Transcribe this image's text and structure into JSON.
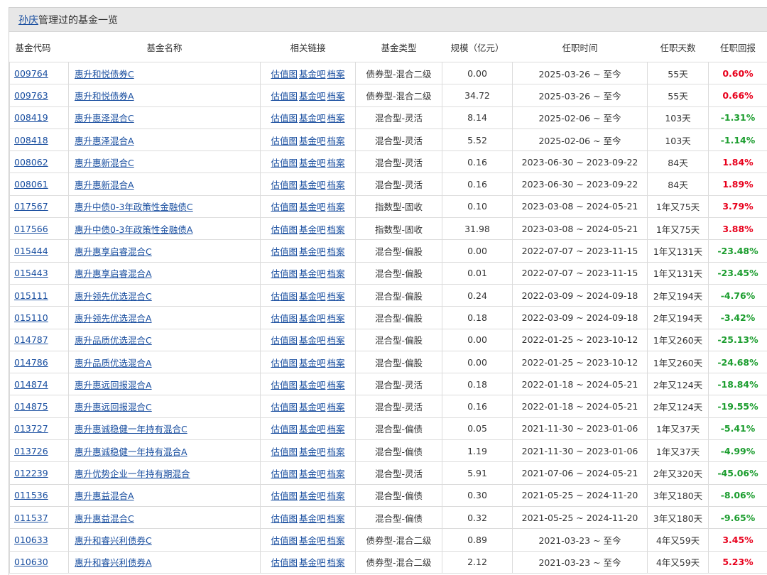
{
  "header": {
    "manager_name": "孙庆",
    "title_suffix": "管理过的基金一览"
  },
  "columns": [
    "基金代码",
    "基金名称",
    "相关链接",
    "基金类型",
    "规模（亿元）",
    "任职时间",
    "任职天数",
    "任职回报"
  ],
  "links": [
    "估值图",
    "基金吧",
    "档案"
  ],
  "colors": {
    "positive": "#e8001c",
    "negative": "#1b9d2e",
    "link": "#1a4fa0"
  },
  "rows": [
    {
      "code": "009764",
      "name": "惠升和悦债券C",
      "type": "债券型-混合二级",
      "scale": "0.00",
      "tenure": "2025-03-26 ~ 至今",
      "days": "55天",
      "return": "0.60%",
      "sign": "pos"
    },
    {
      "code": "009763",
      "name": "惠升和悦债券A",
      "type": "债券型-混合二级",
      "scale": "34.72",
      "tenure": "2025-03-26 ~ 至今",
      "days": "55天",
      "return": "0.66%",
      "sign": "pos"
    },
    {
      "code": "008419",
      "name": "惠升惠泽混合C",
      "type": "混合型-灵活",
      "scale": "8.14",
      "tenure": "2025-02-06 ~ 至今",
      "days": "103天",
      "return": "-1.31%",
      "sign": "neg"
    },
    {
      "code": "008418",
      "name": "惠升惠泽混合A",
      "type": "混合型-灵活",
      "scale": "5.52",
      "tenure": "2025-02-06 ~ 至今",
      "days": "103天",
      "return": "-1.14%",
      "sign": "neg"
    },
    {
      "code": "008062",
      "name": "惠升惠新混合C",
      "type": "混合型-灵活",
      "scale": "0.16",
      "tenure": "2023-06-30 ~ 2023-09-22",
      "days": "84天",
      "return": "1.84%",
      "sign": "pos"
    },
    {
      "code": "008061",
      "name": "惠升惠新混合A",
      "type": "混合型-灵活",
      "scale": "0.16",
      "tenure": "2023-06-30 ~ 2023-09-22",
      "days": "84天",
      "return": "1.89%",
      "sign": "pos"
    },
    {
      "code": "017567",
      "name": "惠升中债0-3年政策性金融债C",
      "type": "指数型-固收",
      "scale": "0.10",
      "tenure": "2023-03-08 ~ 2024-05-21",
      "days": "1年又75天",
      "return": "3.79%",
      "sign": "pos"
    },
    {
      "code": "017566",
      "name": "惠升中债0-3年政策性金融债A",
      "type": "指数型-固收",
      "scale": "31.98",
      "tenure": "2023-03-08 ~ 2024-05-21",
      "days": "1年又75天",
      "return": "3.88%",
      "sign": "pos"
    },
    {
      "code": "015444",
      "name": "惠升惠享启睿混合C",
      "type": "混合型-偏股",
      "scale": "0.00",
      "tenure": "2022-07-07 ~ 2023-11-15",
      "days": "1年又131天",
      "return": "-23.48%",
      "sign": "neg"
    },
    {
      "code": "015443",
      "name": "惠升惠享启睿混合A",
      "type": "混合型-偏股",
      "scale": "0.01",
      "tenure": "2022-07-07 ~ 2023-11-15",
      "days": "1年又131天",
      "return": "-23.45%",
      "sign": "neg"
    },
    {
      "code": "015111",
      "name": "惠升领先优选混合C",
      "type": "混合型-偏股",
      "scale": "0.24",
      "tenure": "2022-03-09 ~ 2024-09-18",
      "days": "2年又194天",
      "return": "-4.76%",
      "sign": "neg"
    },
    {
      "code": "015110",
      "name": "惠升领先优选混合A",
      "type": "混合型-偏股",
      "scale": "0.18",
      "tenure": "2022-03-09 ~ 2024-09-18",
      "days": "2年又194天",
      "return": "-3.42%",
      "sign": "neg"
    },
    {
      "code": "014787",
      "name": "惠升品质优选混合C",
      "type": "混合型-偏股",
      "scale": "0.00",
      "tenure": "2022-01-25 ~ 2023-10-12",
      "days": "1年又260天",
      "return": "-25.13%",
      "sign": "neg"
    },
    {
      "code": "014786",
      "name": "惠升品质优选混合A",
      "type": "混合型-偏股",
      "scale": "0.00",
      "tenure": "2022-01-25 ~ 2023-10-12",
      "days": "1年又260天",
      "return": "-24.68%",
      "sign": "neg"
    },
    {
      "code": "014874",
      "name": "惠升惠远回报混合A",
      "type": "混合型-灵活",
      "scale": "0.18",
      "tenure": "2022-01-18 ~ 2024-05-21",
      "days": "2年又124天",
      "return": "-18.84%",
      "sign": "neg"
    },
    {
      "code": "014875",
      "name": "惠升惠远回报混合C",
      "type": "混合型-灵活",
      "scale": "0.16",
      "tenure": "2022-01-18 ~ 2024-05-21",
      "days": "2年又124天",
      "return": "-19.55%",
      "sign": "neg"
    },
    {
      "code": "013727",
      "name": "惠升惠诚稳健一年持有混合C",
      "type": "混合型-偏债",
      "scale": "0.05",
      "tenure": "2021-11-30 ~ 2023-01-06",
      "days": "1年又37天",
      "return": "-5.41%",
      "sign": "neg"
    },
    {
      "code": "013726",
      "name": "惠升惠诚稳健一年持有混合A",
      "type": "混合型-偏债",
      "scale": "1.19",
      "tenure": "2021-11-30 ~ 2023-01-06",
      "days": "1年又37天",
      "return": "-4.99%",
      "sign": "neg"
    },
    {
      "code": "012239",
      "name": "惠升优势企业一年持有期混合",
      "type": "混合型-灵活",
      "scale": "5.91",
      "tenure": "2021-07-06 ~ 2024-05-21",
      "days": "2年又320天",
      "return": "-45.06%",
      "sign": "neg"
    },
    {
      "code": "011536",
      "name": "惠升惠益混合A",
      "type": "混合型-偏债",
      "scale": "0.30",
      "tenure": "2021-05-25 ~ 2024-11-20",
      "days": "3年又180天",
      "return": "-8.06%",
      "sign": "neg"
    },
    {
      "code": "011537",
      "name": "惠升惠益混合C",
      "type": "混合型-偏债",
      "scale": "0.32",
      "tenure": "2021-05-25 ~ 2024-11-20",
      "days": "3年又180天",
      "return": "-9.65%",
      "sign": "neg"
    },
    {
      "code": "010633",
      "name": "惠升和睿兴利债券C",
      "type": "债券型-混合二级",
      "scale": "0.89",
      "tenure": "2021-03-23 ~ 至今",
      "days": "4年又59天",
      "return": "3.45%",
      "sign": "pos"
    },
    {
      "code": "010630",
      "name": "惠升和睿兴利债券A",
      "type": "债券型-混合二级",
      "scale": "2.12",
      "tenure": "2021-03-23 ~ 至今",
      "days": "4年又59天",
      "return": "5.23%",
      "sign": "pos"
    }
  ]
}
